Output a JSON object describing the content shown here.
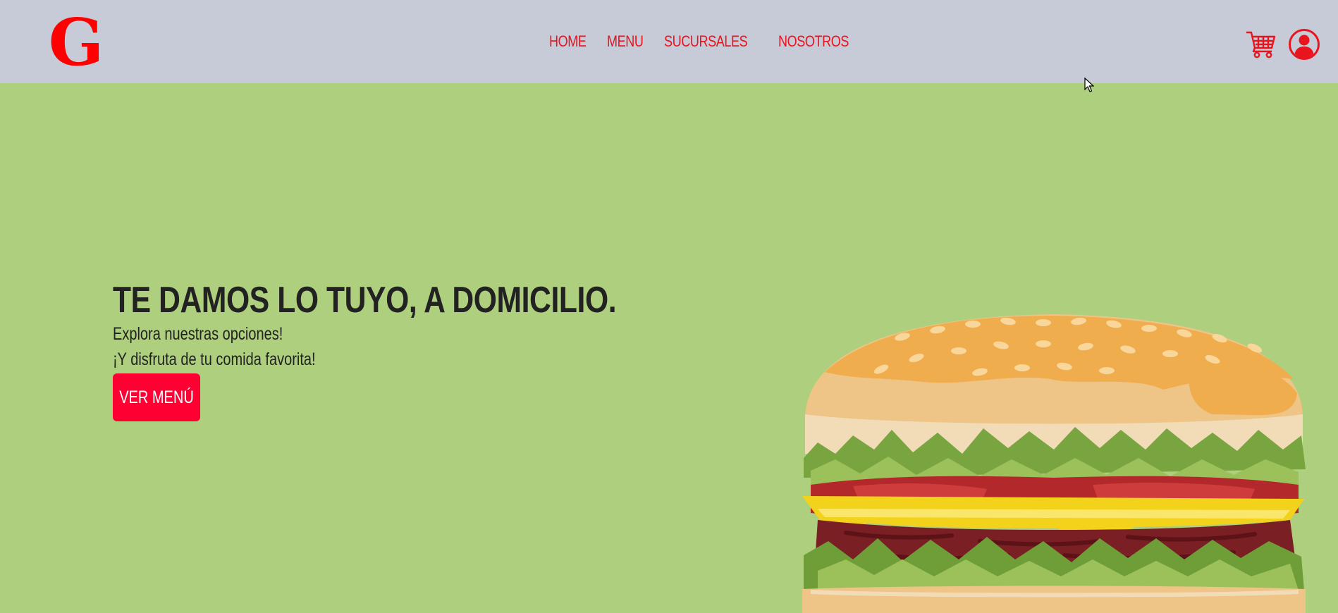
{
  "navbar": {
    "logo_letter": "G",
    "links": [
      {
        "label": "HOME"
      },
      {
        "label": "MENU"
      },
      {
        "label": "SUCURSALES"
      },
      {
        "label": "NOSOTROS"
      }
    ],
    "icons": [
      "cart-icon",
      "user-account-icon"
    ]
  },
  "hero": {
    "title": "TE DAMOS LO TUYO, A DOMICILIO.",
    "subtitle_1": "Explora nuestras opciones!",
    "subtitle_2": "¡Y disfruta de tu comida favorita!",
    "cta_label": "VER MENÚ",
    "image": "hamburger-illustration"
  },
  "colors": {
    "navbar_bg": "#c6cbd7",
    "page_bg": "#aecf7e",
    "accent_red": "#e8141e",
    "button_red": "#ff0033"
  }
}
